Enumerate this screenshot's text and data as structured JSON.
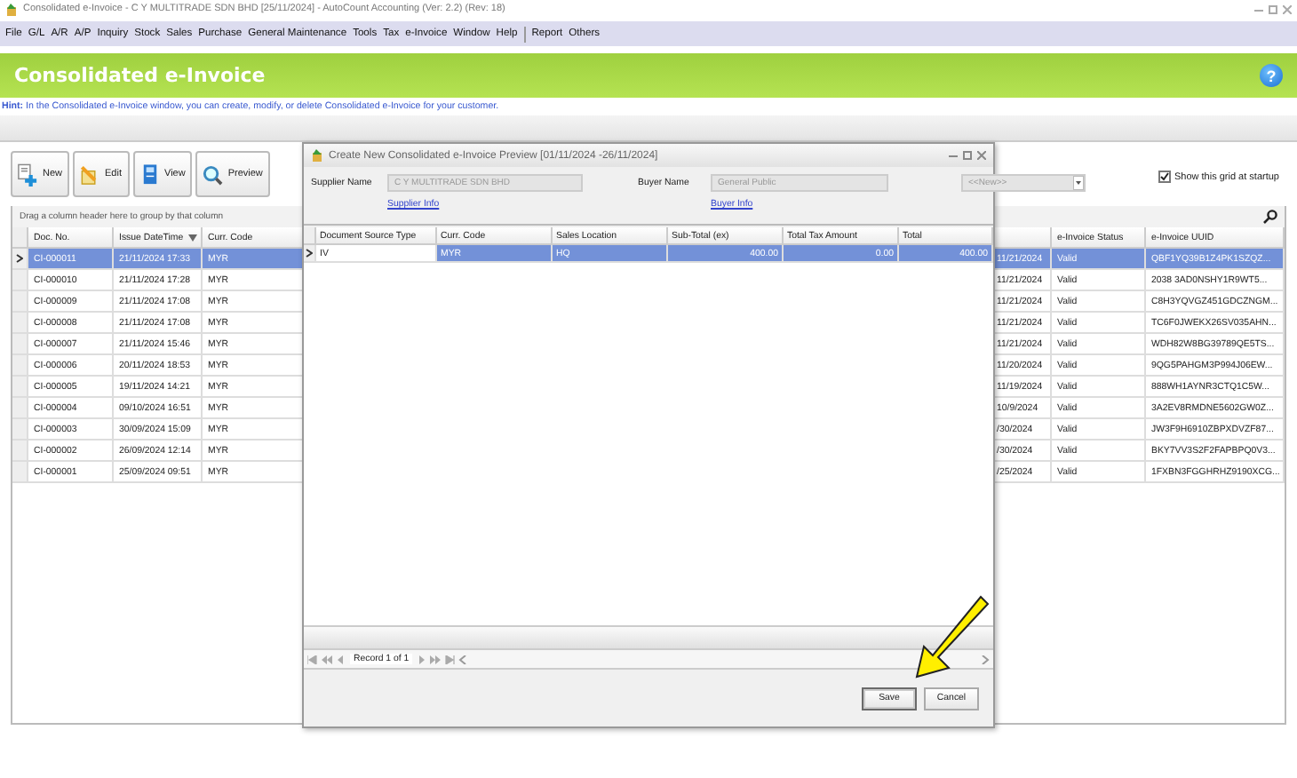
{
  "window": {
    "title": "Consolidated e-Invoice - C Y MULTITRADE SDN BHD [25/11/2024] - AutoCount Accounting (Ver: 2.2) (Rev: 18)"
  },
  "menu": [
    "File",
    "G/L",
    "A/R",
    "A/P",
    "Inquiry",
    "Stock",
    "Sales",
    "Purchase",
    "General Maintenance",
    "Tools",
    "Tax",
    "e-Invoice",
    "Window",
    "Help",
    "Report",
    "Others"
  ],
  "banner": {
    "title": "Consolidated e-Invoice",
    "help": "?"
  },
  "hint": {
    "text": "**Hint:** In the Consolidated e-Invoice window, you can create, modify, or delete Consolidated e-Invoice for your customer."
  },
  "toolbar": [
    {
      "label": "New",
      "kind": "new"
    },
    {
      "label": "Edit",
      "kind": "edit"
    },
    {
      "label": "View",
      "kind": "view"
    },
    {
      "label": "Preview",
      "kind": "preview"
    }
  ],
  "show_grid": {
    "label": "Show this grid at startup",
    "checked": true
  },
  "group_hint": "Drag a column header here to group by that column",
  "grid": {
    "columns": [
      {
        "label": "Doc. No.",
        "sorted": false
      },
      {
        "label": "Issue DateTime",
        "sorted": true
      },
      {
        "label": "Curr. Code",
        "sorted": false
      },
      {
        "label": "e-Invoice Status",
        "sorted": false
      },
      {
        "label": "e-Invoice UUID",
        "sorted": false
      }
    ],
    "rows": [
      {
        "doc_no": "CI-000011",
        "issue_datetime": "21/11/2024 17:33",
        "curr_code": "MYR",
        "column_4": "11/21/2024",
        "status": "Valid",
        "uuid": "QBF1YQ39B1Z4PK1SZQZ...",
        "selected": true
      },
      {
        "doc_no": "CI-000010",
        "issue_datetime": "21/11/2024 17:28",
        "curr_code": "MYR",
        "column_4": "11/21/2024",
        "status": "Valid",
        "uuid": "2038 3AD0NSHY1R9WT5...",
        "selected": false
      },
      {
        "doc_no": "CI-000009",
        "issue_datetime": "21/11/2024 17:08",
        "curr_code": "MYR",
        "column_4": "11/21/2024",
        "status": "Valid",
        "uuid": "C8H3YQVGZ451GDCZNGM...",
        "selected": false
      },
      {
        "doc_no": "CI-000008",
        "issue_datetime": "21/11/2024 17:08",
        "curr_code": "MYR",
        "column_4": "11/21/2024",
        "status": "Valid",
        "uuid": "TC6F0JWEKX26SV035AHN...",
        "selected": false
      },
      {
        "doc_no": "CI-000007",
        "issue_datetime": "21/11/2024 15:46",
        "curr_code": "MYR",
        "column_4": "11/21/2024",
        "status": "Valid",
        "uuid": "WDH82W8BG39789QE5TS...",
        "selected": false
      },
      {
        "doc_no": "CI-000006",
        "issue_datetime": "20/11/2024 18:53",
        "curr_code": "MYR",
        "column_4": "11/20/2024",
        "status": "Valid",
        "uuid": "9QG5PAHGM3P994J06EW...",
        "selected": false
      },
      {
        "doc_no": "CI-000005",
        "issue_datetime": "19/11/2024 14:21",
        "curr_code": "MYR",
        "column_4": "11/19/2024",
        "status": "Valid",
        "uuid": "888WH1AYNR3CTQ1C5W...",
        "selected": false
      },
      {
        "doc_no": "CI-000004",
        "issue_datetime": "09/10/2024 16:51",
        "curr_code": "MYR",
        "column_4": "10/9/2024",
        "status": "Valid",
        "uuid": "3A2EV8RMDNE5602GW0Z...",
        "selected": false
      },
      {
        "doc_no": "CI-000003",
        "issue_datetime": "30/09/2024 15:09",
        "curr_code": "MYR",
        "column_4": "/30/2024",
        "status": "Valid",
        "uuid": "JW3F9H6910ZBPXDVZF87...",
        "selected": false
      },
      {
        "doc_no": "CI-000002",
        "issue_datetime": "26/09/2024 12:14",
        "curr_code": "MYR",
        "column_4": "/30/2024",
        "status": "Valid",
        "uuid": "BKY7VV3S2F2FAPBPQ0V3...",
        "selected": false
      },
      {
        "doc_no": "CI-000001",
        "issue_datetime": "25/09/2024 09:51",
        "curr_code": "MYR",
        "column_4": "/25/2024",
        "status": "Valid",
        "uuid": "1FXBN3FGGHRHZ9190XCG...",
        "selected": false
      }
    ]
  },
  "dialog": {
    "title": "Create New Consolidated e-Invoice Preview [01/11/2024 -26/11/2024]",
    "supplier_label": "Supplier Name",
    "supplier_value": "C Y MULTITRADE SDN BHD",
    "supplier_info": "Supplier Info",
    "buyer_label": "Buyer Name",
    "buyer_value": "General Public",
    "buyer_info": "Buyer Info",
    "combo_value": "<<New>>",
    "columns": [
      "Document Source Type",
      "Curr. Code",
      "Sales Location",
      "Sub-Total (ex)",
      "Total Tax Amount",
      "Total"
    ],
    "rows": [
      {
        "source_type": "IV",
        "curr_code": "MYR",
        "sales_location": "HQ",
        "subtotal": "400.00",
        "tax": "0.00",
        "total": "400.00",
        "selected": true
      }
    ],
    "record_text": "Record 1 of 1",
    "buttons": [
      "Save",
      "Cancel"
    ]
  }
}
